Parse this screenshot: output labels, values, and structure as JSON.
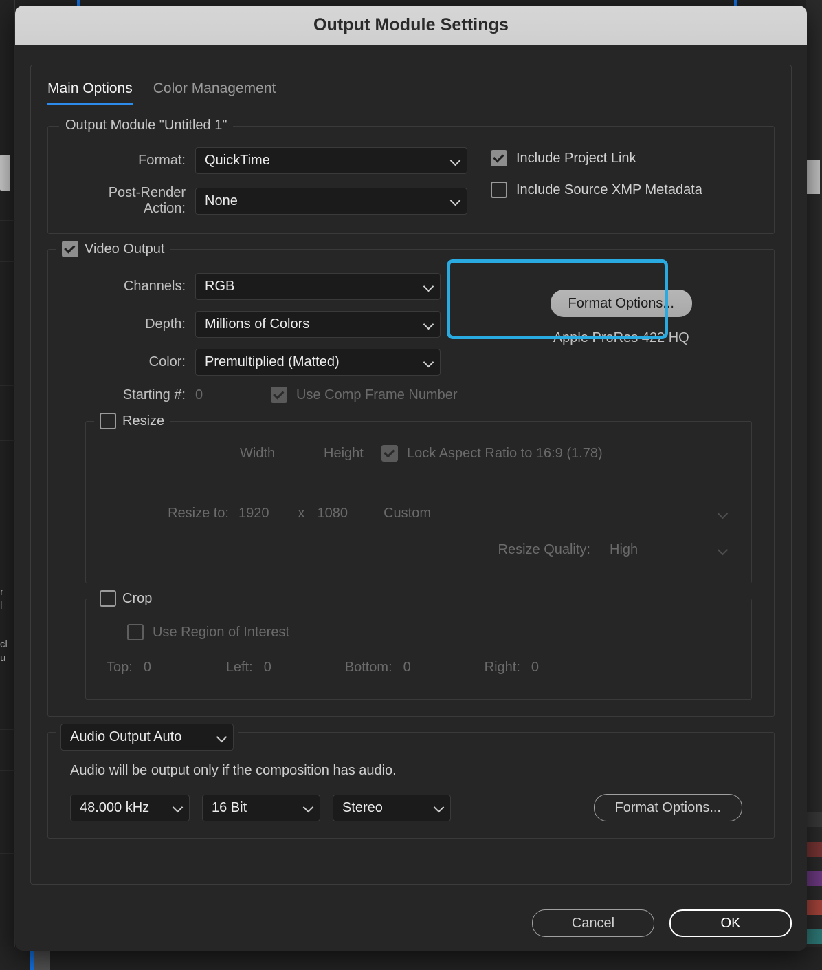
{
  "window": {
    "title": "Output Module Settings"
  },
  "tabs": [
    {
      "label": "Main Options",
      "active": true
    },
    {
      "label": "Color Management",
      "active": false
    }
  ],
  "output_module_group": {
    "legend": "Output Module \"Untitled 1\"",
    "format_label": "Format:",
    "format_value": "QuickTime",
    "post_render_label": "Post-Render Action:",
    "post_render_value": "None",
    "include_project_link": "Include Project Link",
    "include_xmp": "Include Source XMP Metadata"
  },
  "video_output": {
    "legend": "Video Output",
    "channels_label": "Channels:",
    "channels_value": "RGB",
    "depth_label": "Depth:",
    "depth_value": "Millions of Colors",
    "color_label": "Color:",
    "color_value": "Premultiplied (Matted)",
    "starting_label": "Starting #:",
    "starting_value": "0",
    "use_comp_frame_number": "Use Comp Frame Number",
    "format_options_button": "Format Options...",
    "codec_text": "Apple ProRes 422 HQ"
  },
  "resize": {
    "legend": "Resize",
    "width_label": "Width",
    "height_label": "Height",
    "lock_aspect_label": "Lock Aspect Ratio to 16:9 (1.78)",
    "resize_to_label": "Resize to:",
    "resize_width": "1920",
    "times": "x",
    "resize_height": "1080",
    "preset_value": "Custom",
    "quality_label": "Resize Quality:",
    "quality_value": "High"
  },
  "crop": {
    "legend": "Crop",
    "use_roi_label": "Use Region of Interest",
    "top_label": "Top:",
    "top_value": "0",
    "left_label": "Left:",
    "left_value": "0",
    "bottom_label": "Bottom:",
    "bottom_value": "0",
    "right_label": "Right:",
    "right_value": "0"
  },
  "audio": {
    "output_select": "Audio Output Auto",
    "note": "Audio will be output only if the composition has audio.",
    "rate_value": "48.000 kHz",
    "depth_value": "16 Bit",
    "channels_value": "Stereo",
    "format_options_button": "Format Options..."
  },
  "footer": {
    "cancel": "Cancel",
    "ok": "OK"
  },
  "colors": {
    "accent_blue": "#2d8ceb",
    "highlight_cyan": "#29ABE2",
    "dialog_bg": "#262626",
    "titlebar_bg": "#d6d6d6"
  }
}
